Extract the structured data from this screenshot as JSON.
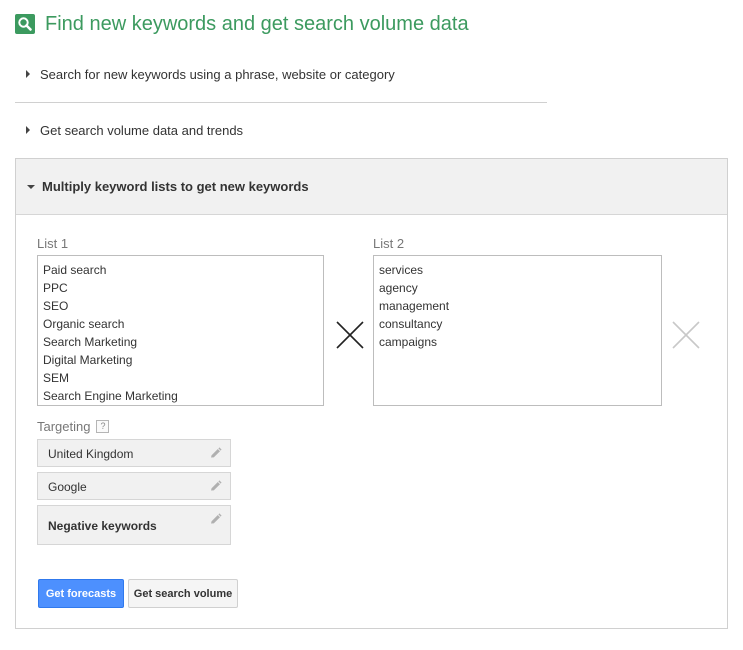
{
  "page": {
    "title": "Find new keywords and get search volume data"
  },
  "sections": {
    "phrase_search": "Search for new keywords using a phrase, website or category",
    "search_volume": "Get search volume data and trends",
    "multiply": "Multiply keyword lists to get new keywords"
  },
  "list1": {
    "label": "List 1",
    "items": [
      "Paid search",
      "PPC",
      "SEO",
      "Organic search",
      "Search Marketing",
      "Digital Marketing",
      "SEM",
      "Search Engine Marketing"
    ]
  },
  "list2": {
    "label": "List 2",
    "items": [
      "services",
      "agency",
      "management",
      "consultancy",
      "campaigns"
    ]
  },
  "targeting": {
    "label": "Targeting",
    "help": "?",
    "location": "United Kingdom",
    "network": "Google",
    "negative_keywords": "Negative keywords"
  },
  "buttons": {
    "get_forecasts": "Get forecasts",
    "get_search_volume": "Get search volume"
  },
  "colors": {
    "brand_green": "#3c9a5f",
    "primary_blue": "#4d90fe"
  },
  "icons": {
    "title": "search-icon",
    "multiply": "multiply-icon",
    "add_list": "add-list-icon",
    "edit": "pencil-icon"
  }
}
